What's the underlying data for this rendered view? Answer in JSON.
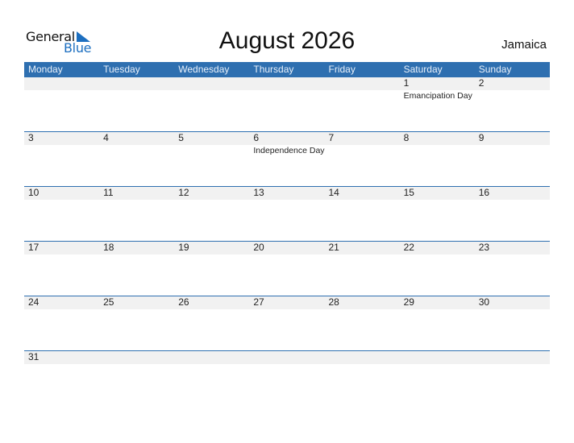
{
  "logo": {
    "general": "General",
    "blue": "Blue"
  },
  "title": "August 2026",
  "country": "Jamaica",
  "colors": {
    "header_bg": "#2e6fb0",
    "row_band": "#f1f1f1",
    "logo_blue": "#1d6fc0"
  },
  "weekdays": [
    "Monday",
    "Tuesday",
    "Wednesday",
    "Thursday",
    "Friday",
    "Saturday",
    "Sunday"
  ],
  "weeks": [
    [
      {
        "day": ""
      },
      {
        "day": ""
      },
      {
        "day": ""
      },
      {
        "day": ""
      },
      {
        "day": ""
      },
      {
        "day": "1",
        "event": "Emancipation Day"
      },
      {
        "day": "2"
      }
    ],
    [
      {
        "day": "3"
      },
      {
        "day": "4"
      },
      {
        "day": "5"
      },
      {
        "day": "6",
        "event": "Independence Day"
      },
      {
        "day": "7"
      },
      {
        "day": "8"
      },
      {
        "day": "9"
      }
    ],
    [
      {
        "day": "10"
      },
      {
        "day": "11"
      },
      {
        "day": "12"
      },
      {
        "day": "13"
      },
      {
        "day": "14"
      },
      {
        "day": "15"
      },
      {
        "day": "16"
      }
    ],
    [
      {
        "day": "17"
      },
      {
        "day": "18"
      },
      {
        "day": "19"
      },
      {
        "day": "20"
      },
      {
        "day": "21"
      },
      {
        "day": "22"
      },
      {
        "day": "23"
      }
    ],
    [
      {
        "day": "24"
      },
      {
        "day": "25"
      },
      {
        "day": "26"
      },
      {
        "day": "27"
      },
      {
        "day": "28"
      },
      {
        "day": "29"
      },
      {
        "day": "30"
      }
    ],
    [
      {
        "day": "31"
      },
      {
        "day": ""
      },
      {
        "day": ""
      },
      {
        "day": ""
      },
      {
        "day": ""
      },
      {
        "day": ""
      },
      {
        "day": ""
      }
    ]
  ]
}
